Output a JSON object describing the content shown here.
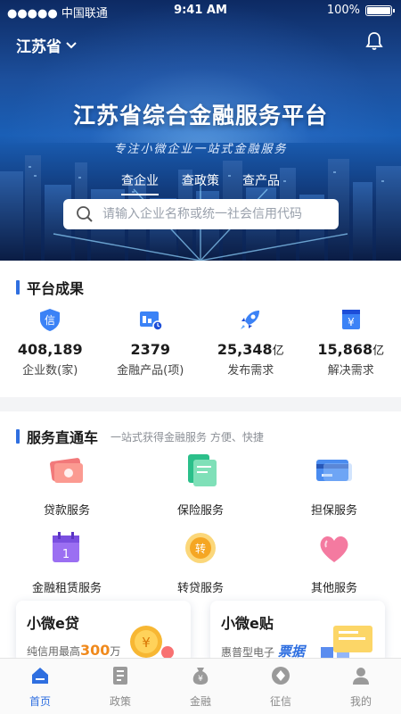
{
  "status_bar": {
    "carrier": "●●●●● 中国联通",
    "time": "9:41 AM",
    "battery": "100%"
  },
  "header": {
    "region": "江苏省"
  },
  "hero": {
    "title": "江苏省综合金融服务平台",
    "subtitle": "专注小微企业一站式金融服务",
    "tabs": [
      {
        "label": "查企业"
      },
      {
        "label": "查政策"
      },
      {
        "label": "查产品"
      }
    ],
    "search_placeholder": "请输入企业名称或统一社会信用代码"
  },
  "achievements": {
    "title": "平台成果",
    "stats": [
      {
        "value": "408,189",
        "unit": "",
        "label": "企业数(家)",
        "icon": "credit-shield-icon"
      },
      {
        "value": "2379",
        "unit": "",
        "label": "金融产品(项)",
        "icon": "product-card-icon"
      },
      {
        "value": "25,348",
        "unit": "亿",
        "label": "发布需求",
        "icon": "rocket-icon"
      },
      {
        "value": "15,868",
        "unit": "亿",
        "label": "解决需求",
        "icon": "yuan-box-icon"
      }
    ]
  },
  "services": {
    "title": "服务直通车",
    "desc": "一站式获得金融服务  方便、快捷",
    "items": [
      {
        "label": "贷款服务",
        "icon": "cash-icon"
      },
      {
        "label": "保险服务",
        "icon": "insurance-doc-icon"
      },
      {
        "label": "担保服务",
        "icon": "bank-card-icon"
      },
      {
        "label": "金融租赁服务",
        "icon": "calendar-icon"
      },
      {
        "label": "转贷服务",
        "icon": "transfer-coin-icon"
      },
      {
        "label": "其他服务",
        "icon": "heart-icon"
      }
    ],
    "cards": [
      {
        "title": "小微e贷",
        "sub_prefix": "纯信用最高",
        "sub_highlight": "300",
        "sub_suffix": "万"
      },
      {
        "title": "小微e贴",
        "sub_prefix": "惠普型电子",
        "sub_highlight": "票据"
      }
    ]
  },
  "nav": [
    {
      "label": "首页",
      "icon": "home-icon",
      "active": true
    },
    {
      "label": "政策",
      "icon": "policy-doc-icon"
    },
    {
      "label": "金融",
      "icon": "money-bag-icon"
    },
    {
      "label": "征信",
      "icon": "credit-icon"
    },
    {
      "label": "我的",
      "icon": "user-icon"
    }
  ],
  "colors": {
    "accent": "#2f6fe0",
    "orange": "#f08a1d"
  }
}
